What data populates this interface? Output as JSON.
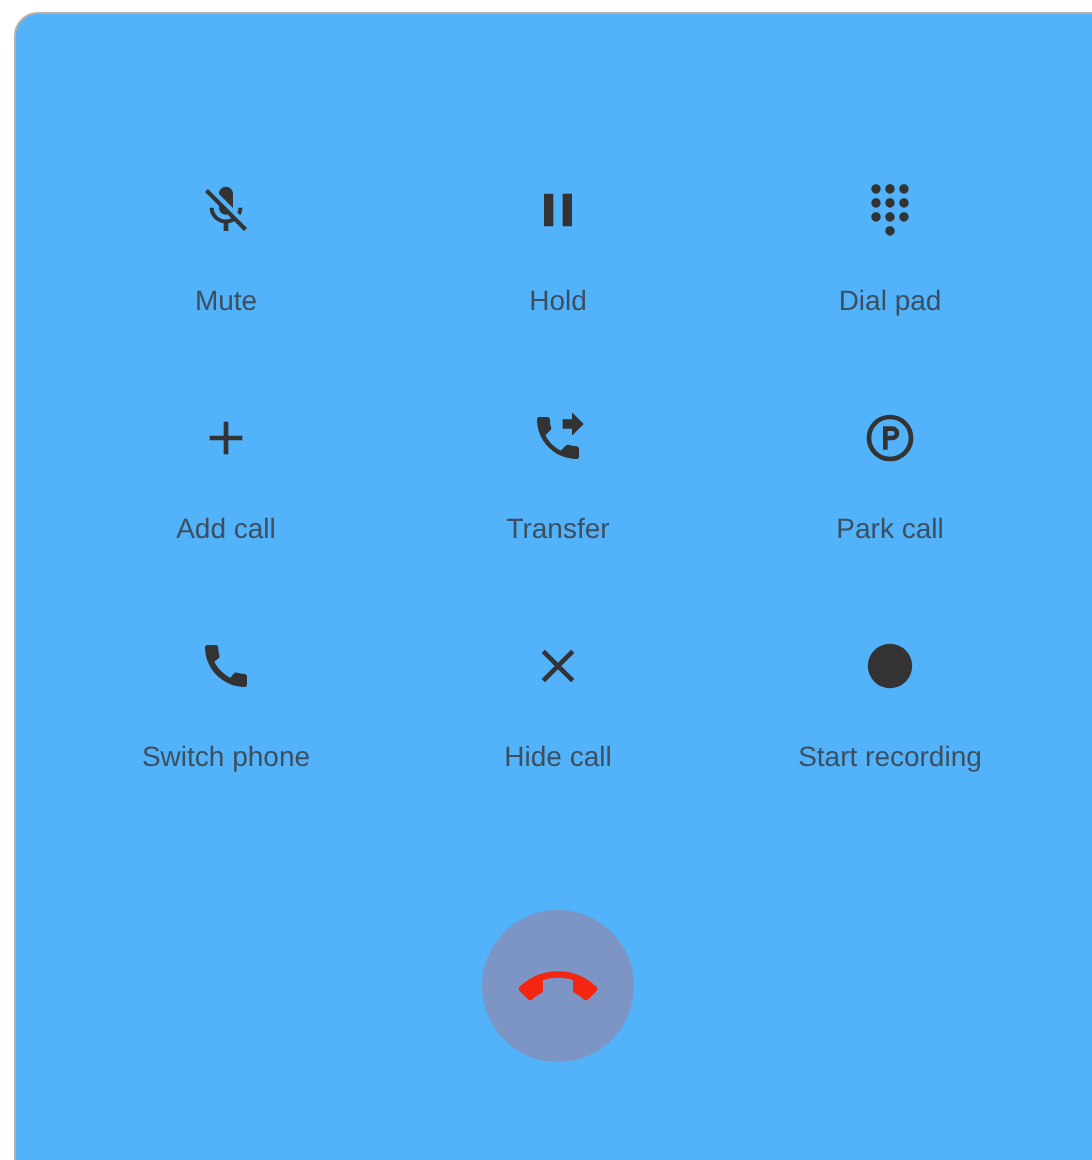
{
  "actions": [
    {
      "kind": "mute",
      "label": "Mute"
    },
    {
      "kind": "hold",
      "label": "Hold"
    },
    {
      "kind": "dialpad",
      "label": "Dial pad"
    },
    {
      "kind": "add",
      "label": "Add call"
    },
    {
      "kind": "transfer",
      "label": "Transfer"
    },
    {
      "kind": "park",
      "label": "Park call"
    },
    {
      "kind": "phone",
      "label": "Switch phone"
    },
    {
      "kind": "hide",
      "label": "Hide call"
    },
    {
      "kind": "record",
      "label": "Start recording"
    }
  ],
  "end_call": {
    "kind": "hang_up"
  }
}
